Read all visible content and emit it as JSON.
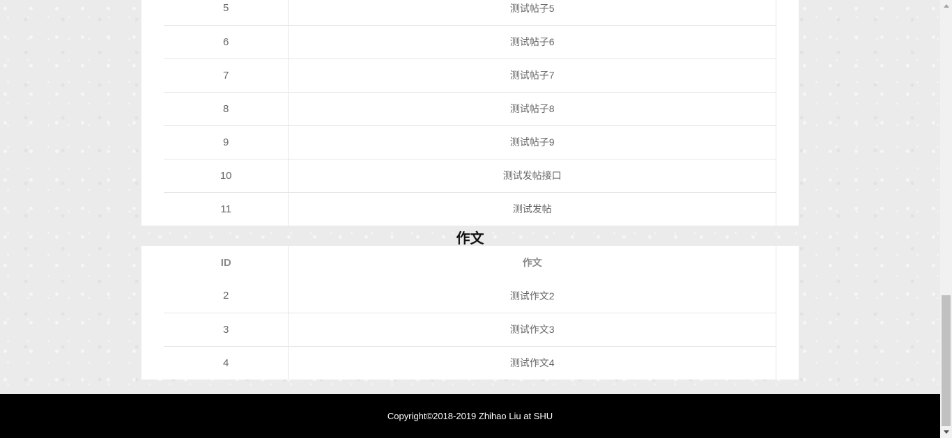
{
  "posts": {
    "rows": [
      {
        "id": "5",
        "title": "测试帖子5"
      },
      {
        "id": "6",
        "title": "测试帖子6"
      },
      {
        "id": "7",
        "title": "测试帖子7"
      },
      {
        "id": "8",
        "title": "测试帖子8"
      },
      {
        "id": "9",
        "title": "测试帖子9"
      },
      {
        "id": "10",
        "title": "测试发帖接口"
      },
      {
        "id": "11",
        "title": "测试发帖"
      }
    ]
  },
  "essays": {
    "heading": "作文",
    "header": {
      "id": "ID",
      "title": "作文"
    },
    "rows": [
      {
        "id": "2",
        "title": "测试作文2"
      },
      {
        "id": "3",
        "title": "测试作文3"
      },
      {
        "id": "4",
        "title": "测试作文4"
      }
    ]
  },
  "footer": {
    "copyright": "Copyright©2018-2019 Zhihao Liu at SHU"
  }
}
